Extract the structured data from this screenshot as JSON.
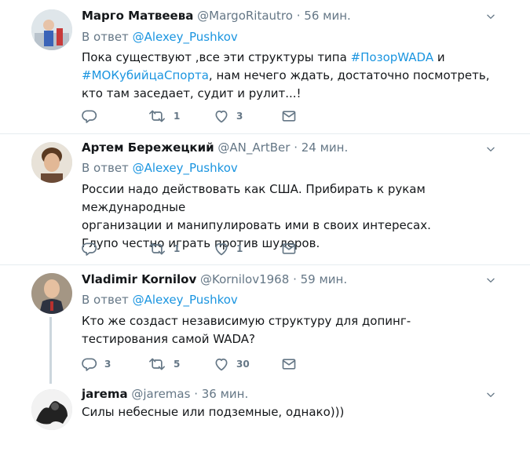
{
  "tweets": [
    {
      "name": "Марго Матвеева",
      "handle": "@MargoRitautro",
      "dot": "·",
      "time": "56 мин.",
      "reply_label": "В ответ",
      "reply_handle": "@Alexey_Pushkov",
      "text_pre": "Пока существуют ,все эти структуры типа ",
      "hashtag1": "#ПозорWADA",
      "text_mid": " и ",
      "hashtag2": "#МОКубийцаСпорта",
      "text_post": ", нам нечего ждать, достаточно посмотреть, кто там заседает, судит и рулит...!",
      "replies": "",
      "retweets": "1",
      "likes": "3"
    },
    {
      "name": "Артем Бережецкий",
      "handle": "@AN_ArtBer",
      "dot": "·",
      "time": "24 мин.",
      "reply_label": "В ответ",
      "reply_handle": "@Alexey_Pushkov",
      "text_line1": "России надо действовать как США. Прибирать к рукам международные",
      "text_line2": "организации и манипулировать ими в своих интересах.",
      "text_line3": "Глупо честно играть против шулеров.",
      "replies": "",
      "retweets": "1",
      "likes": "1"
    },
    {
      "name": "Vladimir Kornilov",
      "handle": "@Kornilov1968",
      "dot": "·",
      "time": "59 мин.",
      "reply_label": "В ответ",
      "reply_handle": "@Alexey_Pushkov",
      "text": "Кто же создаст независимую структуру для допинг-тестирования самой WADA?",
      "replies": "3",
      "retweets": "5",
      "likes": "30"
    },
    {
      "name": "jarema",
      "handle": "@jaremas",
      "dot": "·",
      "time": "36 мин.",
      "text": "Силы небесные или подземные, однако)))"
    }
  ],
  "colors": {
    "accent": "#1b95e0",
    "secondary": "#657786",
    "separator": "#e6ecf0",
    "thread_line": "#ccd6dd"
  }
}
